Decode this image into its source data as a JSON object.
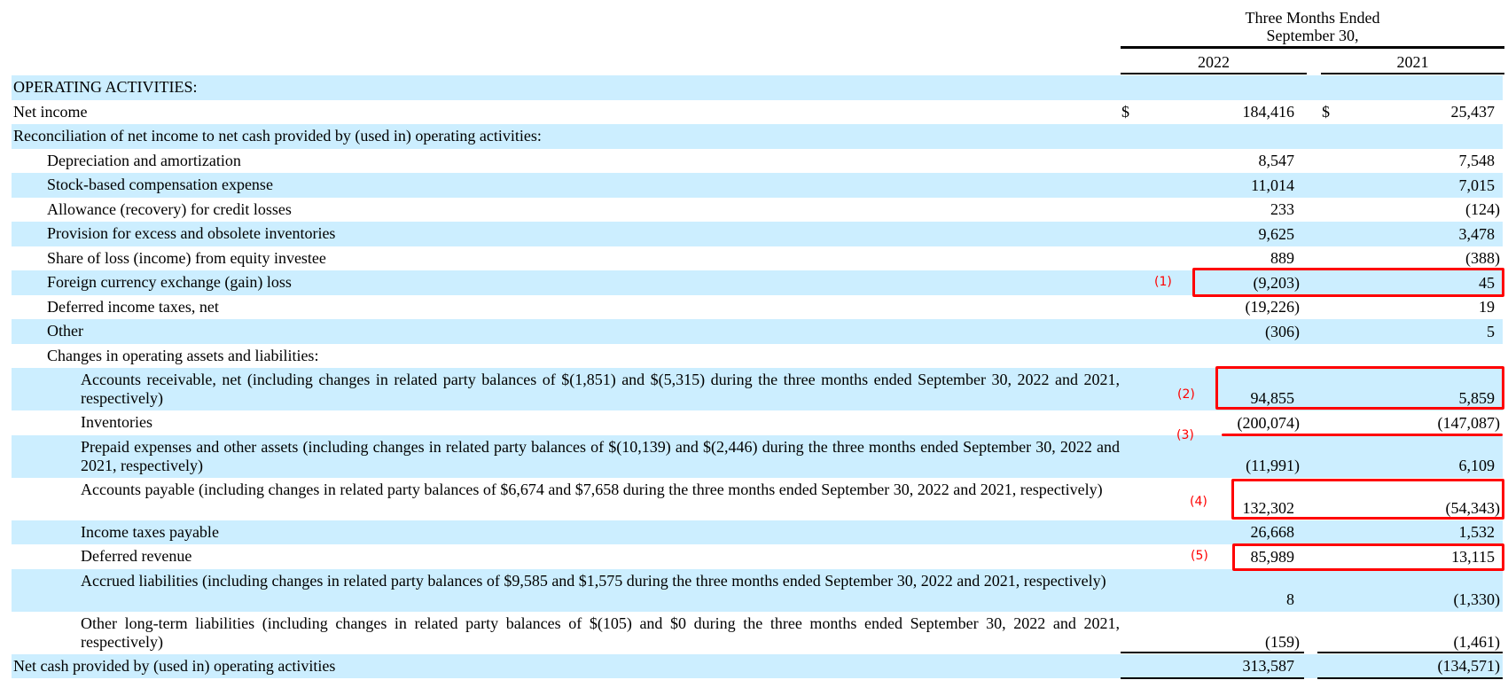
{
  "header": {
    "period_line1": "Three Months Ended",
    "period_line2": "September 30,",
    "years": [
      "2022",
      "2021"
    ]
  },
  "rows": [
    {
      "label": "OPERATING ACTIVITIES:",
      "level": 0,
      "v1": "",
      "v2": "",
      "dollar": false,
      "double": false
    },
    {
      "label": "Net income",
      "level": 0,
      "v1": "184,416",
      "v2": "25,437",
      "dollar": true,
      "double": false
    },
    {
      "label": "Reconciliation of net income to net cash provided by (used in) operating activities:",
      "level": 0,
      "v1": "",
      "v2": "",
      "dollar": false,
      "double": false
    },
    {
      "label": "Depreciation and amortization",
      "level": 1,
      "v1": "8,547",
      "v2": "7,548",
      "dollar": false,
      "double": false
    },
    {
      "label": "Stock-based compensation expense",
      "level": 1,
      "v1": "11,014",
      "v2": "7,015",
      "dollar": false,
      "double": false
    },
    {
      "label": "Allowance (recovery) for credit losses",
      "level": 1,
      "v1": "233",
      "v2": "(124)",
      "dollar": false,
      "double": false
    },
    {
      "label": "Provision for excess and obsolete inventories",
      "level": 1,
      "v1": "9,625",
      "v2": "3,478",
      "dollar": false,
      "double": false
    },
    {
      "label": "Share of loss (income) from equity investee",
      "level": 1,
      "v1": "889",
      "v2": "(388)",
      "dollar": false,
      "double": false
    },
    {
      "label": "Foreign currency exchange (gain) loss",
      "level": 1,
      "v1": "(9,203)",
      "v2": "45",
      "dollar": false,
      "double": false
    },
    {
      "label": "Deferred income taxes, net",
      "level": 1,
      "v1": "(19,226)",
      "v2": "19",
      "dollar": false,
      "double": false
    },
    {
      "label": "Other",
      "level": 1,
      "v1": "(306)",
      "v2": "5",
      "dollar": false,
      "double": false
    },
    {
      "label": "Changes in operating assets and liabilities:",
      "level": 1,
      "v1": "",
      "v2": "",
      "dollar": false,
      "double": false
    },
    {
      "label": "Accounts receivable, net (including changes in related party balances of $(1,851) and $(5,315) during the three months ended September 30, 2022 and 2021, respectively)",
      "level": 2,
      "v1": "94,855",
      "v2": "5,859",
      "dollar": false,
      "double": true
    },
    {
      "label": "Inventories",
      "level": 2,
      "v1": "(200,074)",
      "v2": "(147,087)",
      "dollar": false,
      "double": false
    },
    {
      "label": "Prepaid expenses and other assets (including changes in related party balances of $(10,139) and $(2,446) during the three months ended September 30, 2022 and 2021, respectively)",
      "level": 2,
      "v1": "(11,991)",
      "v2": "6,109",
      "dollar": false,
      "double": true
    },
    {
      "label": "Accounts payable (including changes in related party balances of $6,674 and $7,658 during the three months ended September 30, 2022 and 2021, respectively)",
      "level": 2,
      "v1": "132,302",
      "v2": "(54,343)",
      "dollar": false,
      "double": true
    },
    {
      "label": "Income taxes payable",
      "level": 2,
      "v1": "26,668",
      "v2": "1,532",
      "dollar": false,
      "double": false
    },
    {
      "label": "Deferred revenue",
      "level": 2,
      "v1": "85,989",
      "v2": "13,115",
      "dollar": false,
      "double": false
    },
    {
      "label": "Accrued liabilities (including changes in related party balances of $9,585 and $1,575 during the three months ended September 30, 2022 and 2021, respectively)",
      "level": 2,
      "v1": "8",
      "v2": "(1,330)",
      "dollar": false,
      "double": true
    },
    {
      "label": "Other long-term liabilities (including changes in related party balances of $(105) and $0 during the three months ended September 30, 2022 and 2021, respectively)",
      "level": 2,
      "v1": "(159)",
      "v2": "(1,461)",
      "dollar": false,
      "double": true
    },
    {
      "label": "Net cash provided by (used in) operating activities",
      "level": 0,
      "v1": "313,587",
      "v2": "(134,571)",
      "dollar": false,
      "double": false
    }
  ],
  "currency_symbol": "$",
  "annotations": {
    "a1": "(1)",
    "a2": "(2)",
    "a3": "(3)",
    "a4": "(4)",
    "a5": "(5)",
    "color": "#ff0000"
  },
  "colors": {
    "stripe": "#cceeff"
  }
}
